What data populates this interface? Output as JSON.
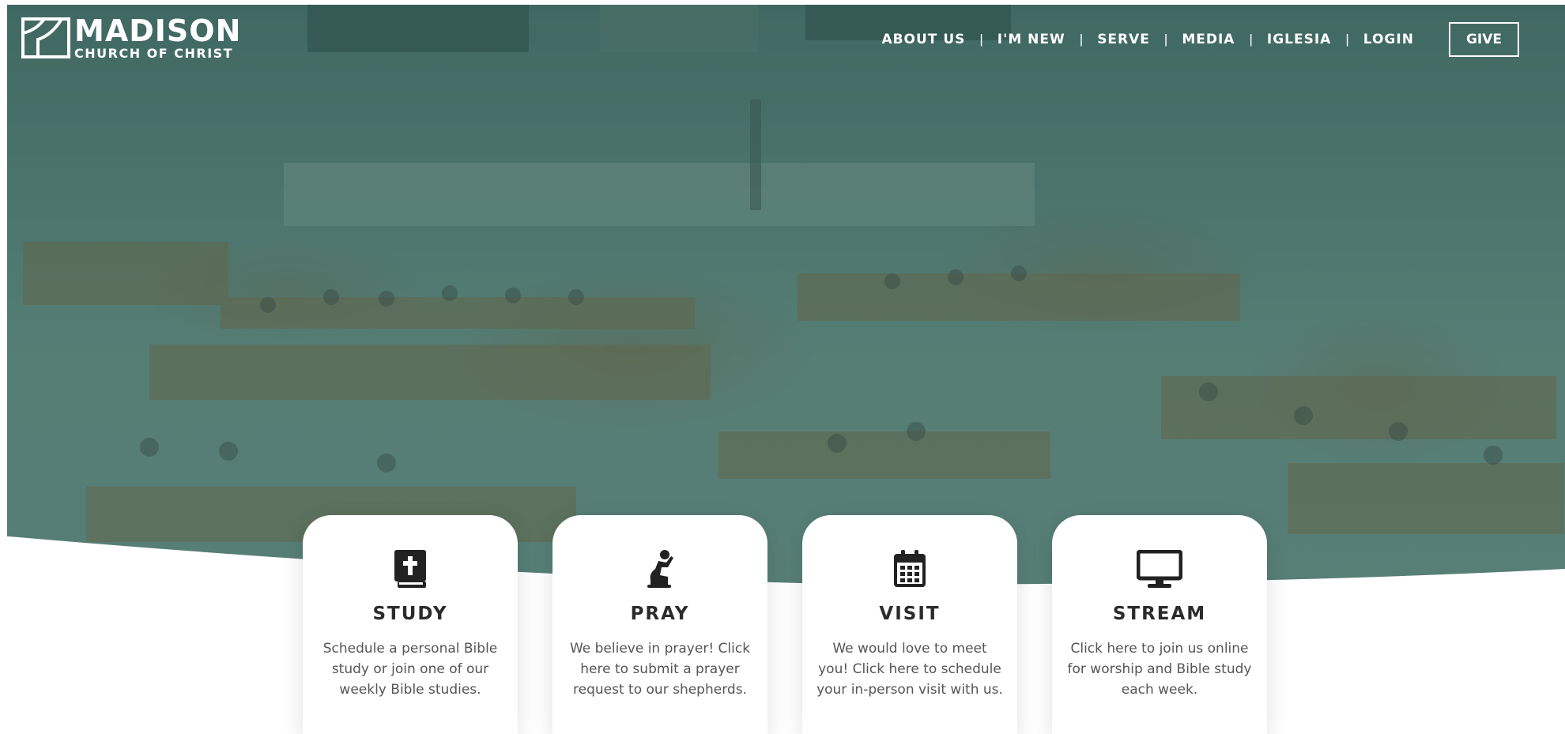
{
  "logo": {
    "title": "MADISON",
    "subtitle": "CHURCH OF CHRIST",
    "icon": "logo-mark"
  },
  "nav": {
    "items": [
      {
        "label": "ABOUT US"
      },
      {
        "label": "I'M NEW"
      },
      {
        "label": "SERVE"
      },
      {
        "label": "MEDIA"
      },
      {
        "label": "IGLESIA"
      },
      {
        "label": "LOGIN"
      }
    ],
    "separator": "|",
    "give_label": "GIVE"
  },
  "cards": [
    {
      "title": "STUDY",
      "text": "Schedule a personal Bible study or join one of our weekly Bible studies.",
      "icon": "bible-icon"
    },
    {
      "title": "PRAY",
      "text": "We believe in prayer! Click here to submit a prayer request to our shepherds.",
      "icon": "praying-person-icon"
    },
    {
      "title": "VISIT",
      "text": "We would love to meet you! Click here to schedule your in-person visit with us.",
      "icon": "calendar-icon"
    },
    {
      "title": "STREAM",
      "text": "Click here to join us online for worship and Bible study each week.",
      "icon": "monitor-icon"
    }
  ],
  "colors": {
    "overlay": "#2d5f55",
    "icon": "#222222",
    "title": "#2b2b2b",
    "text": "#555555",
    "nav": "#ffffff"
  }
}
